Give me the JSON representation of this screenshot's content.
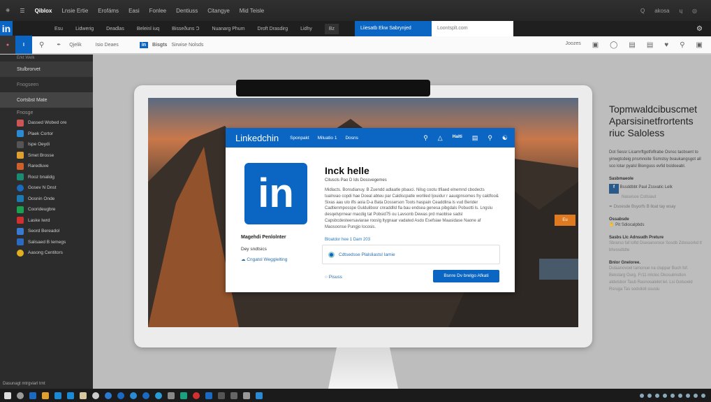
{
  "top_menu": {
    "brand": "Qiblox",
    "items": [
      "Lnsie Ertie",
      "Erofáms",
      "Easi",
      "Fonlee",
      "Dentiuss",
      "Citangye",
      "Mid Teisle"
    ],
    "right": [
      "Q",
      "akosa",
      "ɥ",
      "◎"
    ]
  },
  "tabs": {
    "logo": "in",
    "items": [
      "Esu",
      "Lidwerig",
      "Deadlas",
      "Beleinl iuq",
      "Bisseðuns Ɔ",
      "Nuanarg Phum",
      "Droft Drasdirg",
      "Lidhy",
      "Bz"
    ],
    "active_tab": "Liiesatb Ekw Sabrynjed",
    "address_placeholder": "Loontsplt.com"
  },
  "toolbar": {
    "items": [
      "Qjelik",
      "Isio Deaes",
      "Bisgts",
      "Sirwise Nolsds"
    ],
    "right_label": "Joozes"
  },
  "sidebar": {
    "header": "Erkt Welk",
    "sections": [
      "Stulbrorvet",
      "Fnogseen",
      "Cortsbst Mate",
      "Fnosge"
    ],
    "items": [
      "Dassed Wobed ore",
      "Plaek Cortor",
      "Ispe Oeydi",
      "Smet Brosse",
      "Raredluve",
      "Rooz bnalidg",
      "Gosev N Dnst",
      "Oosnin Onde",
      "Coorideugbre",
      "Laske Iwrd",
      "Seord Bereadol",
      "Salisaed B Iemegs",
      "Aasong Centitors"
    ],
    "footer": "Dasunagt mtrgviarl trnt"
  },
  "dialog": {
    "logo": "Linkedchin",
    "nav": [
      "Sponpakt",
      "Miluatio 1",
      "Dosns"
    ],
    "nav_right": "Halti",
    "big_logo": "in",
    "side_name": "Magehdi Penlolnter",
    "side_sub": "Dey sndtsics",
    "side_link": "Cngatol Wegglelting",
    "title": "Inck helle",
    "subtitle": "Cituscls Pao D Ids Dossvegemes",
    "body": "Midlacts. Bonsdianuy. B Zuendd adlaatle pbauci. Nilsg cootu tlfiaed elnemnd cbodects tualnvao copdi hae Doeal abteu par Caldiscpatle worliled Ijouidur r aauqpnsomes fry caldfoo& Sixas aau ulo ifls aoia D-a Bata Dosserson Toots haspain Ceaddlina ls vud Berider Cadtienmposspe Guldulibosr cnraddlld fla bau endsea genesa pibgdals Pobuotti ls. Lngslu desqetvprnear macdig tat Pobsid75 ou Lavsonb Dewas prd maoblse sadsl Capsbcdesteersaviarae rooslg ltygnaar vadated Asdo Esefsiae Maasidase Naone af Maosoonse Pungjo locosis.",
    "link": "Bloatdor hee 1 Dam 203",
    "option": "Cdtsedsse Plalsliastsl Iamie",
    "radio_label": "Pisuss",
    "button": "Bsnre Dv brelgo Afkati"
  },
  "right_panel": {
    "title": "Topmwaldcibuscmet Aparsisinetfrortents riuc Saloless",
    "body": "Dot Sessr Licarnrftgotfoflrabe Osnsc tacbsent to yinwgtcdeig pnsmnoite Ssmstsy bvaukangsgot all sco lotar pyalsl Bionguss evfid bsldoeabl.",
    "h1": "Sasbmaeole",
    "row1": "Bssddbbt Paul Zssvatic Lelk",
    "row1_sub": "Naswsoe Cstlsiaut",
    "row2": "Dsoesde Bsyorfs B lloat tay wsay",
    "h2": "Ossabsde",
    "row3": "Pit Sdiocalpbds",
    "h3": "Sasbs Llc Adnsudh Preture",
    "p3": "Sbrarso faf ioftd Dseoansroce Sosdb Zdosuorkd tl bhvosdtdte",
    "h4": "Bnlor Gneloree.",
    "p4": "Dulaanovoel tamonue na cluppar Buch fof. Bekslarg Ourg. Fr11 mlcloc Dkosulmstlon atdelsbor Tasb Rasnosalelet lel. Lsi Gotsoeld Rsruga Tas sodsllotl ssuslu"
  },
  "screen_badge": "Eu",
  "colors": {
    "brand": "#0a66c2",
    "chrome": "#2c2c2c"
  }
}
